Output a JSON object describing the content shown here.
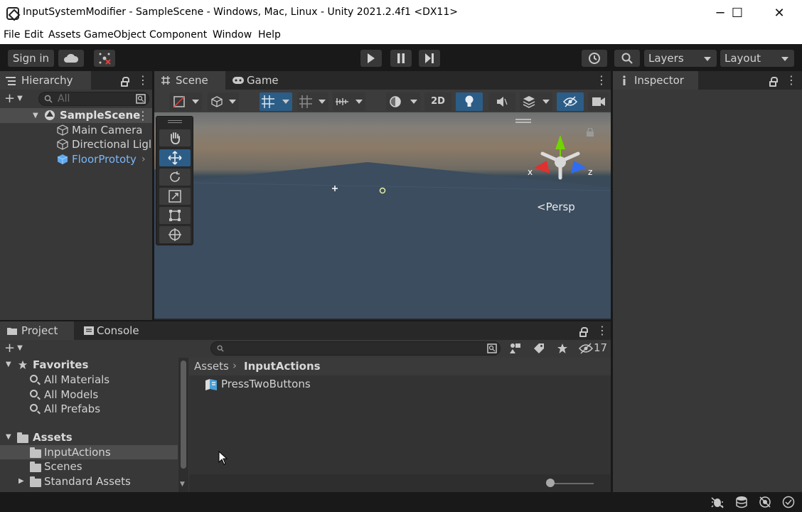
{
  "window": {
    "title": "InputSystemModifier - SampleScene - Windows, Mac, Linux - Unity 2021.2.4f1 <DX11>",
    "minimize": "─",
    "maximize": "☐",
    "close": "✕"
  },
  "menu": [
    "File",
    "Edit",
    "Assets",
    "GameObject",
    "Component",
    "Window",
    "Help"
  ],
  "toolbar": {
    "sign_in": "Sign in",
    "layers": "Layers",
    "layout": "Layout"
  },
  "hierarchy": {
    "tab": "Hierarchy",
    "search_placeholder": "All",
    "scene": "SampleScene",
    "items": [
      "Main Camera",
      "Directional Ligl",
      "FloorPrototy"
    ]
  },
  "scene": {
    "tab_scene": "Scene",
    "tab_game": "Game",
    "btn_2d": "2D",
    "gizmo_x": "x",
    "gizmo_z": "z",
    "persp": "Persp"
  },
  "inspector": {
    "tab": "Inspector"
  },
  "project": {
    "tab_project": "Project",
    "tab_console": "Console",
    "hidden_count": "17",
    "favorites": "Favorites",
    "favorites_items": [
      "All Materials",
      "All Models",
      "All Prefabs"
    ],
    "assets": "Assets",
    "asset_folders": [
      "InputActions",
      "Scenes",
      "Standard Assets"
    ],
    "breadcrumb_root": "Assets",
    "breadcrumb_current": "InputActions",
    "files": [
      "PressTwoButtons"
    ]
  },
  "colors": {
    "accent": "#2c5d87",
    "selection": "#4d4d4d",
    "link_blue": "#7cb6f7",
    "panel": "#383838",
    "window": "#191919"
  }
}
